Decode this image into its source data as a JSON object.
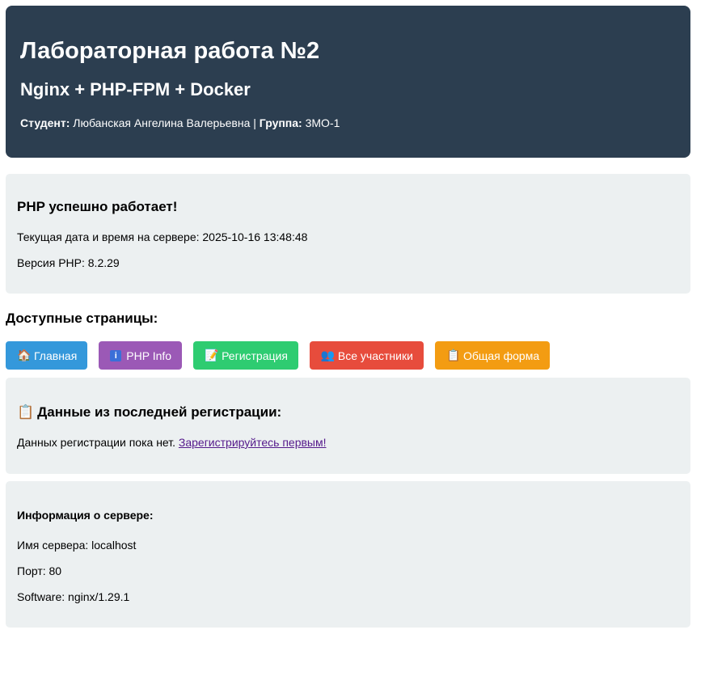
{
  "header": {
    "title": "Лабораторная работа №2",
    "subtitle": "Nginx + PHP-FPM + Docker",
    "student_label": "Студент:",
    "student_name": "Любанская Ангелина Валерьевна",
    "separator": "|",
    "group_label": "Группа:",
    "group_value": "3МО-1",
    "bg_color": "#2c3e50"
  },
  "status": {
    "heading": "PHP успешно работает!",
    "datetime_text": "Текущая дата и время на сервере: 2025-10-16 13:48:48",
    "php_version_text": "Версия PHP: 8.2.29"
  },
  "pages": {
    "heading": "Доступные страницы:",
    "links": [
      {
        "icon": "home-icon",
        "glyph": "🏠",
        "label": "Главная",
        "color": "#3498db"
      },
      {
        "icon": "info-icon",
        "glyph": "i",
        "label": "PHP Info",
        "color": "#9b59b6"
      },
      {
        "icon": "memo-icon",
        "glyph": "📝",
        "label": "Регистрация",
        "color": "#2ecc71"
      },
      {
        "icon": "people-icon",
        "glyph": "👥",
        "label": "Все участники",
        "color": "#e74c3c"
      },
      {
        "icon": "clipboard-icon",
        "glyph": "📋",
        "label": "Общая форма",
        "color": "#f39c12"
      }
    ]
  },
  "registration": {
    "icon": "clipboard-icon",
    "glyph": "📋",
    "heading": "Данные из последней регистрации:",
    "empty_text": "Данных регистрации пока нет.",
    "link_text": "Зарегистрируйтесь первым!"
  },
  "server": {
    "heading": "Информация о сервере:",
    "name_text": "Имя сервера: localhost",
    "port_text": "Порт: 80",
    "software_text": "Software: nginx/1.29.1"
  }
}
